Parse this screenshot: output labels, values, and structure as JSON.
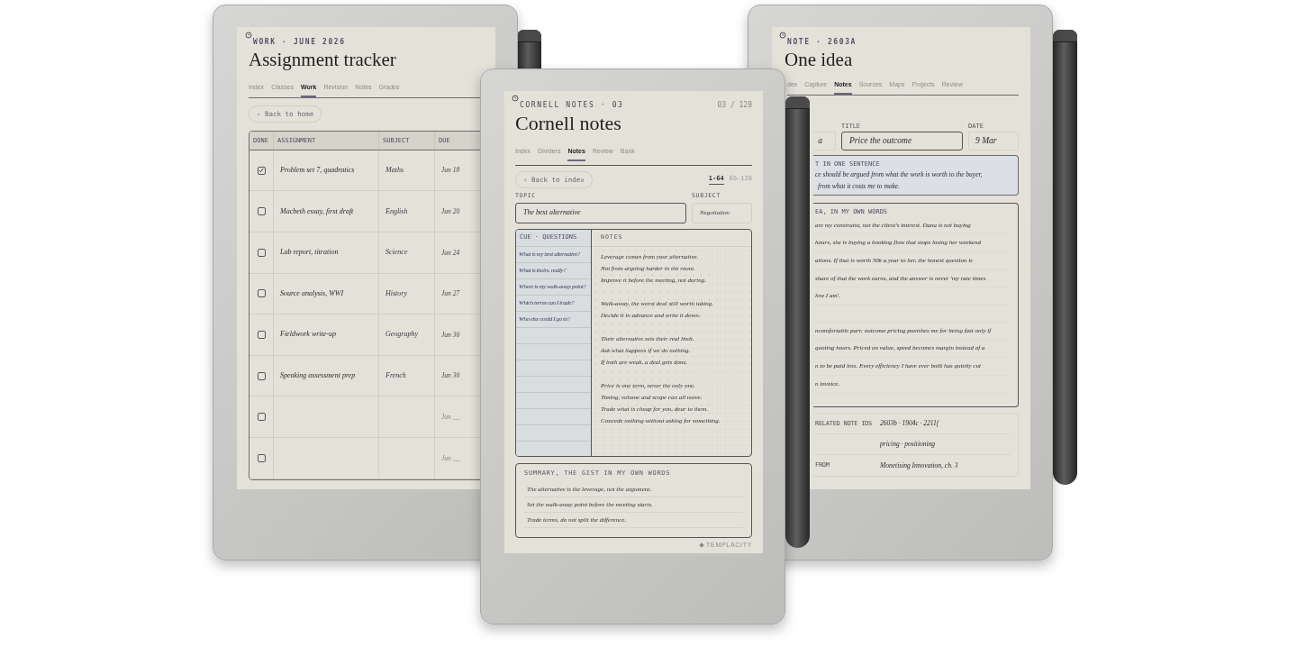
{
  "tracker": {
    "eyebrow": "WORK · JUNE 2026",
    "title": "Assignment tracker",
    "tabs": [
      {
        "label": "Index",
        "selected": false
      },
      {
        "label": "Classes",
        "selected": false
      },
      {
        "label": "Work",
        "selected": true
      },
      {
        "label": "Revision",
        "selected": false
      },
      {
        "label": "Notes",
        "selected": false
      },
      {
        "label": "Grades",
        "selected": false
      }
    ],
    "back_button": "‹ Back to home",
    "table": {
      "columns": [
        "DONE",
        "ASSIGNMENT",
        "SUBJECT",
        "DUE"
      ],
      "rows": [
        {
          "checked": true,
          "assignment": "Problem set 7, quadratics",
          "subject": "Maths",
          "due": "Jun 18"
        },
        {
          "checked": false,
          "assignment": "Macbeth essay, first draft",
          "subject": "English",
          "due": "Jun 20"
        },
        {
          "checked": false,
          "assignment": "Lab report, titration",
          "subject": "Science",
          "due": "Jun 24"
        },
        {
          "checked": false,
          "assignment": "Source analysis, WWI",
          "subject": "History",
          "due": "Jun 27"
        },
        {
          "checked": false,
          "assignment": "Fieldwork write-up",
          "subject": "Geography",
          "due": "Jun 30"
        },
        {
          "checked": false,
          "assignment": "Speaking assessment prep",
          "subject": "French",
          "due": "Jun 30"
        },
        {
          "checked": false,
          "due_hint": "Jun __"
        },
        {
          "checked": false,
          "due_hint": "Jun __"
        }
      ]
    }
  },
  "cornell": {
    "eyebrow": "CORNELL NOTES · 03",
    "page": "03 / 128",
    "title": "Cornell notes",
    "tabs": [
      {
        "label": "Index",
        "selected": false
      },
      {
        "label": "Dividers",
        "selected": false
      },
      {
        "label": "Notes",
        "selected": true
      },
      {
        "label": "Review",
        "selected": false
      },
      {
        "label": "Bank",
        "selected": false
      }
    ],
    "back_button": "‹ Back to index",
    "ranges": [
      {
        "label": "1-64",
        "selected": true
      },
      {
        "label": "65-128",
        "selected": false
      }
    ],
    "topic": {
      "label": "TOPIC",
      "value": "The best alternative"
    },
    "subject": {
      "label": "SUBJECT",
      "value": "Negotiation"
    },
    "cue_header": "CUE · QUESTIONS",
    "cues": [
      "What is my best alternative?",
      "What is theirs, really?",
      "Where is my walk-away point?",
      "Which terms can I trade?",
      "Who else could I go to?"
    ],
    "notes_header": "NOTES",
    "note_groups": [
      [
        "Leverage comes from your alternative.",
        "Not from arguing harder in the room.",
        "Improve it before the meeting, not during."
      ],
      [
        "Walk-away, the worst deal still worth taking.",
        "Decide it in advance and write it down."
      ],
      [
        "Their alternative sets their real limit.",
        "Ask what happens if we do nothing.",
        "If both are weak, a deal gets done."
      ],
      [
        "Price is one term, never the only one.",
        "Timing, volume and scope can all move.",
        "Trade what is cheap for you, dear to them.",
        "Concede nothing without asking for something."
      ]
    ],
    "summary": {
      "header": "SUMMARY, THE GIST IN MY OWN WORDS",
      "lines": [
        "The alternative is the leverage, not the argument.",
        "Set the walk-away point before the meeting starts.",
        "Trade terms, do not split the difference."
      ]
    },
    "logo": "TEMPLACITY"
  },
  "note": {
    "eyebrow": "NOTE · 2603A",
    "title": "One idea",
    "tabs": [
      {
        "label": "dex",
        "selected": false
      },
      {
        "label": "Capture",
        "selected": false
      },
      {
        "label": "Notes",
        "selected": true
      },
      {
        "label": "Sources",
        "selected": false
      },
      {
        "label": "Maps",
        "selected": false
      },
      {
        "label": "Projects",
        "selected": false
      },
      {
        "label": "Review",
        "selected": false
      }
    ],
    "fields": [
      {
        "value": "a"
      },
      {
        "label": "TITLE",
        "value": "Price the outcome"
      },
      {
        "label": "DATE",
        "value": "9 Mar"
      }
    ],
    "sentence": {
      "header": "T IN ONE SENTENCE",
      "lines": [
        "ce should be argued from what the work is worth to the buyer,",
        "from what it costs me to make."
      ]
    },
    "idea": {
      "header": "EA, IN MY OWN WORDS",
      "paragraphs": [
        [
          "are my constraint, not the client's interest. Dana is not buying",
          "hours, she is buying a booking flow that stops losing her weekend",
          "ations. If that is worth 30k a year to her, the honest question is",
          "share of that the work earns, and the answer is never 'my rate times",
          "low I am'."
        ],
        [
          "ncomfortable part: outcome pricing punishes me for being fast only if",
          "quoting hours. Priced on value, speed becomes margin instead of a",
          "n to be paid less. Every efficiency I have ever built has quietly cut",
          "n invoice."
        ]
      ]
    },
    "meta": [
      {
        "label": "RELATED NOTE IDS",
        "value": "2603b · 1904c · 2211f"
      },
      {
        "value": "pricing · positioning"
      },
      {
        "label": "FROM",
        "value": "Monetising Innovation, ch. 3"
      }
    ]
  }
}
